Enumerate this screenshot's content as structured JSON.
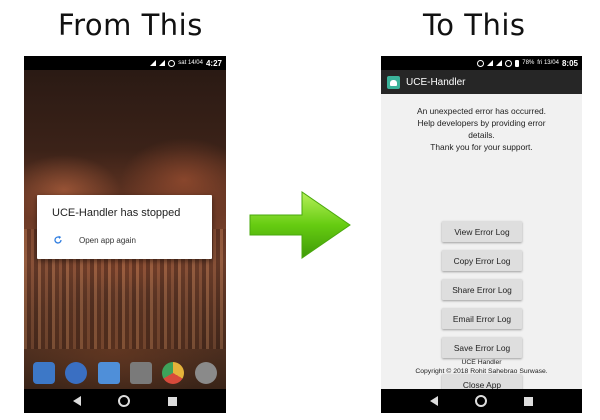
{
  "captions": {
    "left": "From This",
    "right": "To This"
  },
  "left_phone": {
    "status": {
      "date": "sat 14/04",
      "clock": "4:27"
    },
    "dialog": {
      "title": "UCE-Handler has stopped",
      "action": "Open app again"
    }
  },
  "right_phone": {
    "status": {
      "battery": "78%",
      "date": "fri 13/04",
      "clock": "8:05"
    },
    "app_title": "UCE-Handler",
    "message": [
      "An unexpected error has occurred.",
      "Help developers by providing error",
      "details.",
      "Thank you for your support."
    ],
    "buttons": [
      "View Error Log",
      "Copy Error Log",
      "Share Error Log",
      "Email Error Log",
      "Save Error Log",
      "Close App"
    ],
    "footer": [
      "UCE Handler",
      "Copyright © 2018 Rohit Sahebrao Surwase."
    ]
  },
  "colors": {
    "arrow": "#66cc11",
    "accent": "#3bb39a",
    "appbar": "#262626"
  }
}
